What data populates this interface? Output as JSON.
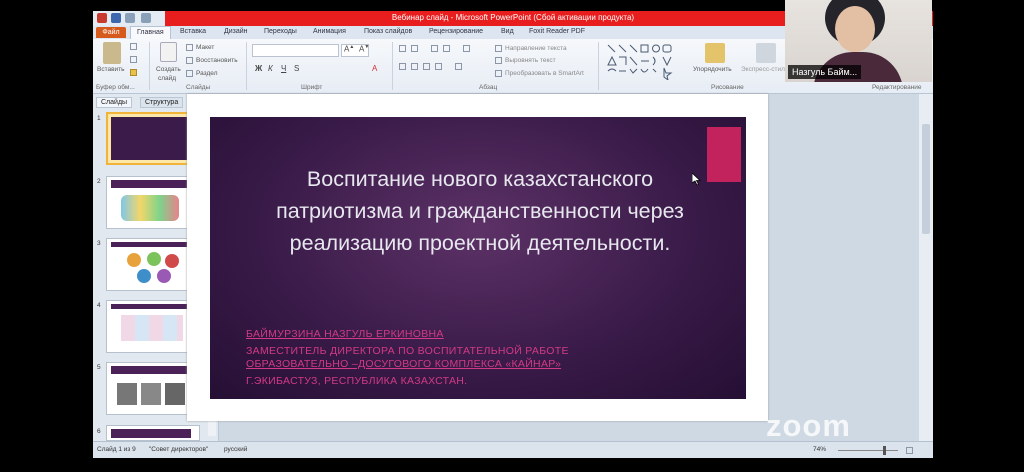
{
  "window": {
    "title": "Вебинар слайд - Microsoft PowerPoint (Сбой активации продукта)"
  },
  "ribbon_tabs": {
    "file": "Файл",
    "home": "Главная",
    "insert": "Вставка",
    "design": "Дизайн",
    "transitions": "Переходы",
    "animation": "Анимация",
    "slideshow": "Показ слайдов",
    "review": "Рецензирование",
    "view": "Вид",
    "foxit": "Foxit Reader PDF"
  },
  "ribbon": {
    "paste": "Вставить",
    "new_slide_l1": "Создать",
    "new_slide_l2": "слайд",
    "layout": "Макет",
    "reset": "Восстановить",
    "section": "Раздел",
    "clipboard_group": "Буфер обм...",
    "slides_group": "Слайды",
    "font_group": "Шрифт",
    "paragraph_group": "Абзац",
    "drawing_group": "Рисование",
    "editing_group": "Редактирование",
    "text_direction": "Направление текста",
    "align_text": "Выровнять текст",
    "convert_smartart": "Преобразовать в SmartArt",
    "arrange": "Упорядочить",
    "quick_styles": "Экспресс-стили"
  },
  "panel": {
    "tab_slides": "Слайды",
    "tab_outline": "Структура",
    "close": "×",
    "thumb_nums": [
      "1",
      "2",
      "3",
      "4",
      "5",
      "6"
    ]
  },
  "slide": {
    "title": "Воспитание нового казахстанского патриотизма и гражданственности через реализацию проектной деятельности.",
    "author": "БАЙМУРЗИНА НАЗГУЛЬ ЕРКИНОВНА",
    "position_l1": "ЗАМЕСТИТЕЛЬ ДИРЕКТОРА ПО ВОСПИТАТЕЛЬНОЙ РАБОТЕ",
    "position_l2": "ОБРАЗОВАТЕЛЬНО –ДОСУГОВОГО КОМПЛЕКСА «КАЙНАР»",
    "city": "Г.ЭКИБАСТУЗ, РЕСПУБЛИКА КАЗАХСТАН."
  },
  "status": {
    "slide_info": "Слайд 1 из 9",
    "theme": "\"Совет директоров\"",
    "language": "русский",
    "zoom": "74%"
  },
  "webcam": {
    "name": "Назгуль Байм..."
  },
  "overlay": {
    "zoom_logo": "zoom"
  }
}
